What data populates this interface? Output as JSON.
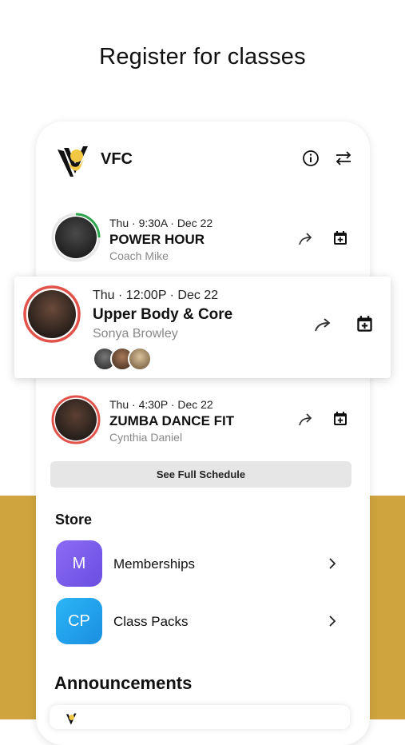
{
  "headline": "Register for classes",
  "app": {
    "brand": "VFC",
    "info_icon": "info-icon",
    "switch_icon": "switch-arrows-icon"
  },
  "classes": [
    {
      "when": "Thu · 9:30A · Dec 22",
      "title": "POWER HOUR",
      "coach": "Coach Mike",
      "ring_color": "#2ea44f"
    },
    {
      "when": "Thu · 12:00P · Dec 22",
      "title": "Upper Body & Core",
      "coach": "Sonya  Browley",
      "ring_color": "#e0524a"
    },
    {
      "when": "Thu · 4:30P · Dec 22",
      "title": "ZUMBA DANCE FIT",
      "coach": "Cynthia Daniel",
      "ring_color": "#e0524a"
    }
  ],
  "schedule_button": "See Full Schedule",
  "store": {
    "heading": "Store",
    "items": [
      {
        "initials": "M",
        "label": "Memberships",
        "color": "#7b5cf0"
      },
      {
        "initials": "CP",
        "label": "Class Packs",
        "color": "#1da1f2"
      }
    ]
  },
  "announcements": {
    "heading": "Announcements"
  },
  "colors": {
    "accent_gold": "#cfa43f"
  }
}
